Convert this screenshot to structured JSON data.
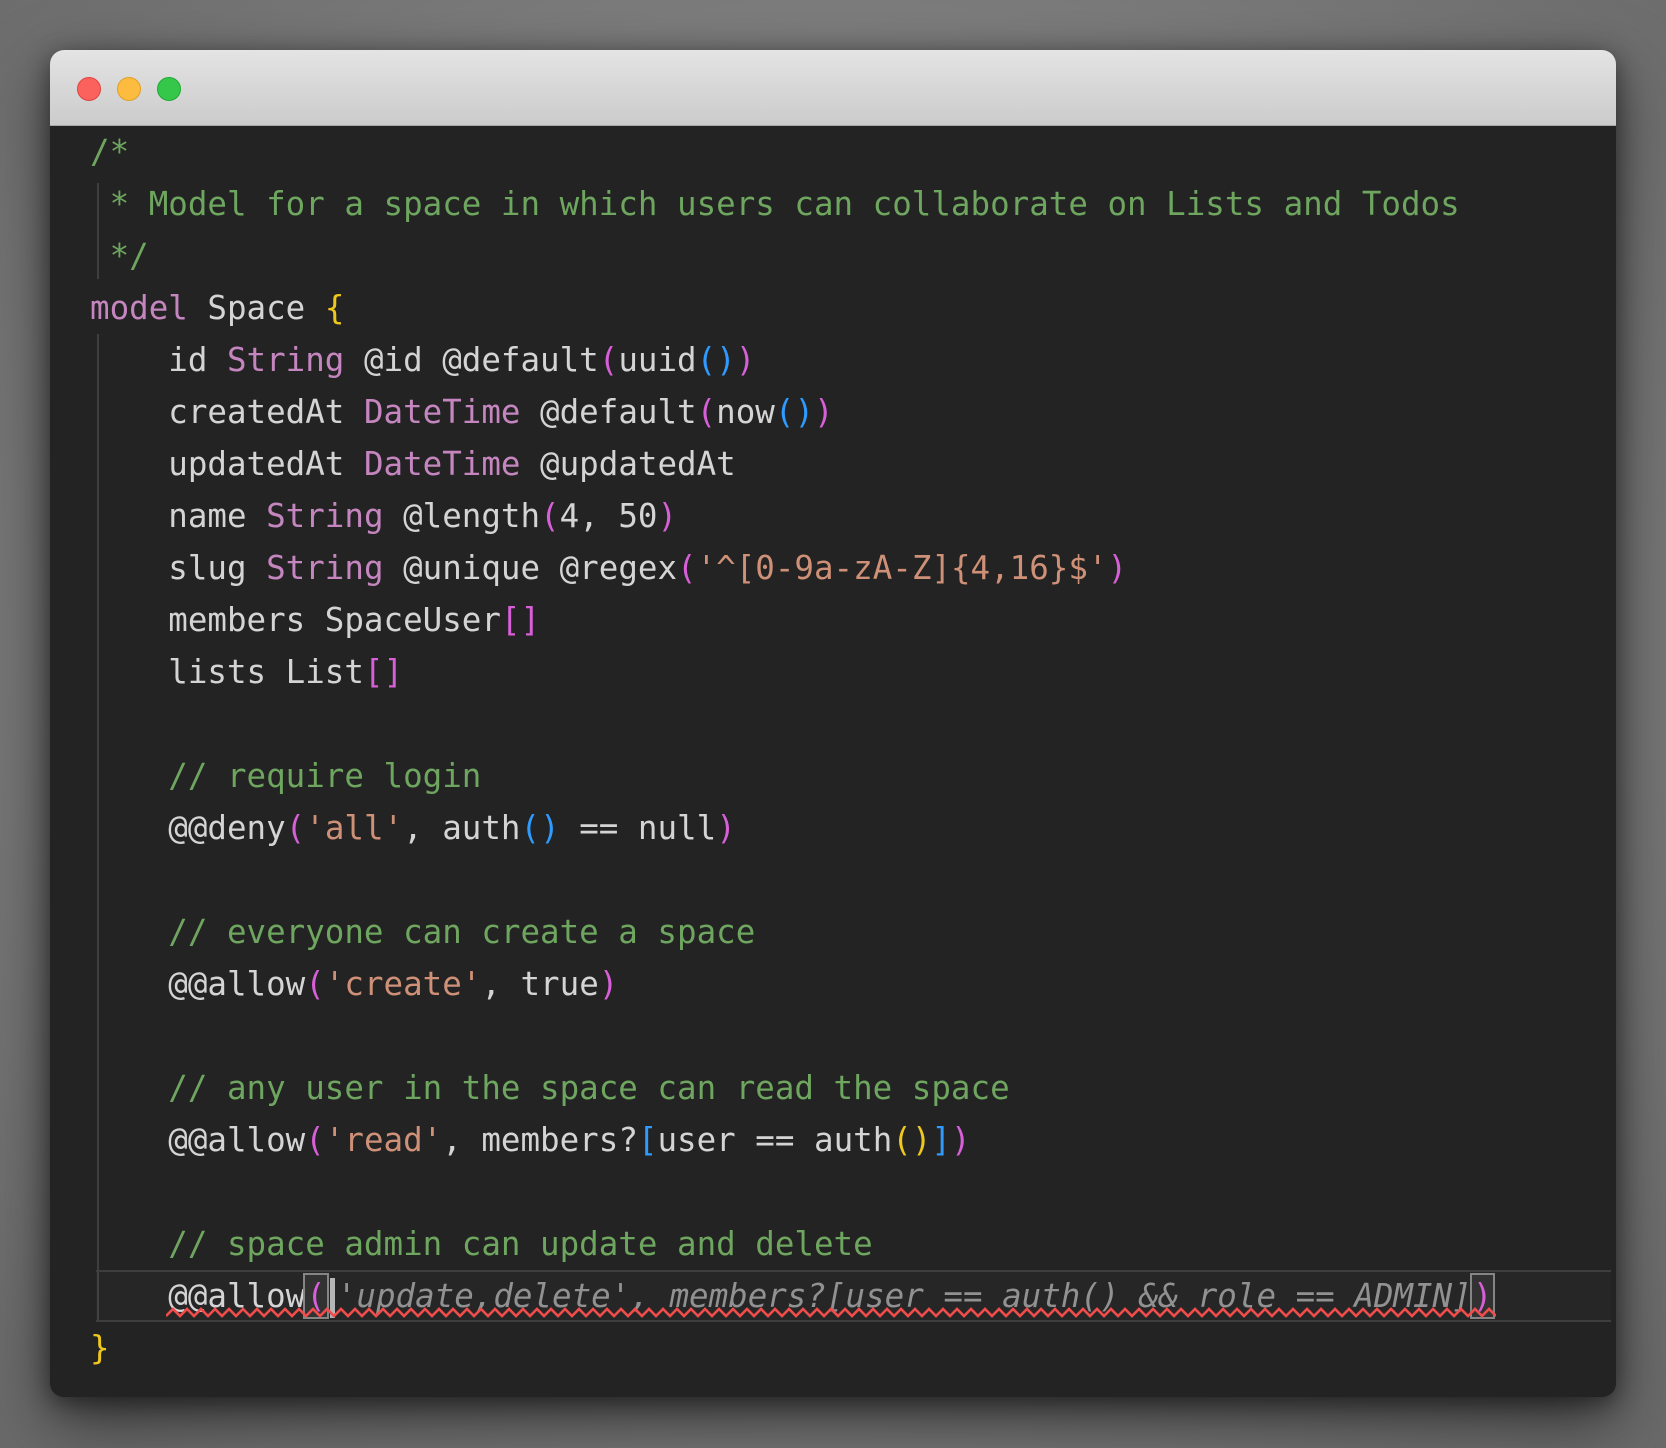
{
  "window": {
    "kind": "macos-window",
    "titlebar": {
      "traffic_lights": [
        {
          "name": "close",
          "color": "#fc625d"
        },
        {
          "name": "minimize",
          "color": "#fdbc40"
        },
        {
          "name": "zoom",
          "color": "#34c749"
        }
      ]
    }
  },
  "palette": {
    "desktop_background": "#7d7d7d",
    "editor_background": "#232323",
    "titlebar_background": "#d6d6d6",
    "text_plain": "#d4d4d4",
    "keyword_and_type": "#c586c0",
    "comment": "#6ea55f",
    "string": "#ce9178",
    "bracket_level_1_gold": "#efc81e",
    "bracket_level_2_orchid": "#d75fd7",
    "bracket_level_3_blue": "#2f9bff",
    "ghost_suggestion_text": "#919191",
    "error_squiggle": "#f14c4c",
    "indent_guide": "#3f3f3f",
    "bracket_match_box_border": "#858585",
    "cursor": "#b5b5b5"
  },
  "code": {
    "language": "zmodel",
    "ghost_suggestion": "'update,delete', members?[user == auth() && role == ADMIN]",
    "lines": [
      {
        "segments": [
          [
            "cmt",
            "/*"
          ]
        ]
      },
      {
        "segments": [
          [
            "cmt",
            " * Model for a space in which users can collaborate on Lists and Todos"
          ]
        ]
      },
      {
        "segments": [
          [
            "cmt",
            " */"
          ]
        ]
      },
      {
        "segments": [
          [
            "kw",
            "model"
          ],
          [
            "pl",
            " Space "
          ],
          [
            "b1",
            "{"
          ]
        ]
      },
      {
        "segments": [
          [
            "pl",
            "    id "
          ],
          [
            "ty",
            "String"
          ],
          [
            "pl",
            " @id @default"
          ],
          [
            "b2",
            "("
          ],
          [
            "pl",
            "uuid"
          ],
          [
            "b3",
            "()"
          ],
          [
            "b2",
            ")"
          ]
        ]
      },
      {
        "segments": [
          [
            "pl",
            "    createdAt "
          ],
          [
            "ty",
            "DateTime"
          ],
          [
            "pl",
            " @default"
          ],
          [
            "b2",
            "("
          ],
          [
            "pl",
            "now"
          ],
          [
            "b3",
            "()"
          ],
          [
            "b2",
            ")"
          ]
        ]
      },
      {
        "segments": [
          [
            "pl",
            "    updatedAt "
          ],
          [
            "ty",
            "DateTime"
          ],
          [
            "pl",
            " @updatedAt"
          ]
        ]
      },
      {
        "segments": [
          [
            "pl",
            "    name "
          ],
          [
            "ty",
            "String"
          ],
          [
            "pl",
            " @length"
          ],
          [
            "b2",
            "("
          ],
          [
            "pl",
            "4, 50"
          ],
          [
            "b2",
            ")"
          ]
        ]
      },
      {
        "segments": [
          [
            "pl",
            "    slug "
          ],
          [
            "ty",
            "String"
          ],
          [
            "pl",
            " @unique @regex"
          ],
          [
            "b2",
            "("
          ],
          [
            "str",
            "'^[0-9a-zA-Z]{4,16}$'"
          ],
          [
            "b2",
            ")"
          ]
        ]
      },
      {
        "segments": [
          [
            "pl",
            "    members SpaceUser"
          ],
          [
            "b2",
            "[]"
          ]
        ]
      },
      {
        "segments": [
          [
            "pl",
            "    lists List"
          ],
          [
            "b2",
            "[]"
          ]
        ]
      },
      {
        "segments": []
      },
      {
        "segments": [
          [
            "cmt",
            "    // require login"
          ]
        ]
      },
      {
        "segments": [
          [
            "pl",
            "    @@deny"
          ],
          [
            "b2",
            "("
          ],
          [
            "str",
            "'all'"
          ],
          [
            "pl",
            ", auth"
          ],
          [
            "b3",
            "()"
          ],
          [
            "pl",
            " == null"
          ],
          [
            "b2",
            ")"
          ]
        ]
      },
      {
        "segments": []
      },
      {
        "segments": [
          [
            "cmt",
            "    // everyone can create a space"
          ]
        ]
      },
      {
        "segments": [
          [
            "pl",
            "    @@allow"
          ],
          [
            "b2",
            "("
          ],
          [
            "str",
            "'create'"
          ],
          [
            "pl",
            ", true"
          ],
          [
            "b2",
            ")"
          ]
        ]
      },
      {
        "segments": []
      },
      {
        "segments": [
          [
            "cmt",
            "    // any user in the space can read the space"
          ]
        ]
      },
      {
        "segments": [
          [
            "pl",
            "    @@allow"
          ],
          [
            "b2",
            "("
          ],
          [
            "str",
            "'read'"
          ],
          [
            "pl",
            ", members?"
          ],
          [
            "b3",
            "["
          ],
          [
            "pl",
            "user == auth"
          ],
          [
            "b1",
            "()"
          ],
          [
            "b3",
            "]"
          ],
          [
            "b2",
            ")"
          ]
        ]
      },
      {
        "segments": []
      },
      {
        "segments": [
          [
            "cmt",
            "    // space admin can update and delete"
          ]
        ]
      },
      {
        "segments": [
          [
            "pl",
            "    @@allow"
          ],
          [
            "b2m",
            "("
          ],
          [
            "cursor",
            ""
          ],
          [
            "ghost",
            "'update,delete', members?[user == auth() && role == ADMIN]"
          ],
          [
            "b2m",
            ")"
          ]
        ]
      },
      {
        "segments": [
          [
            "b1",
            "}"
          ]
        ]
      }
    ]
  }
}
